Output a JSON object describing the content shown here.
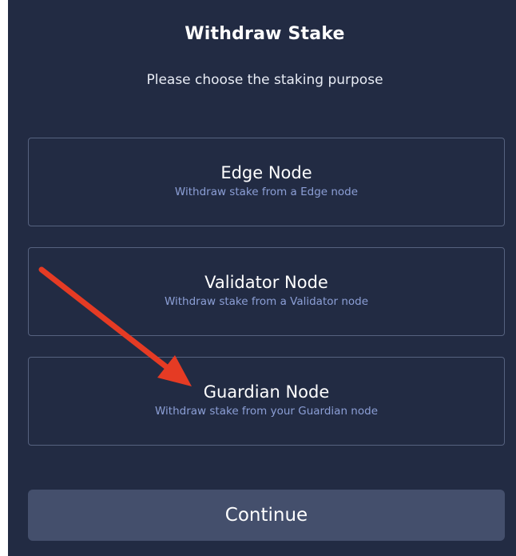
{
  "dialog": {
    "title": "Withdraw Stake",
    "subtitle": "Please choose the staking purpose"
  },
  "options": [
    {
      "title": "Edge Node",
      "description": "Withdraw stake from a Edge node"
    },
    {
      "title": "Validator Node",
      "description": "Withdraw stake from a Validator node"
    },
    {
      "title": "Guardian Node",
      "description": "Withdraw stake from your Guardian node"
    }
  ],
  "footer": {
    "continue_label": "Continue"
  },
  "annotation": {
    "icon": "red-arrow-icon",
    "color": "#e53b24",
    "points_to": "Guardian Node"
  },
  "colors": {
    "background": "#222b43",
    "border": "#56627f",
    "description": "#8c9fd6",
    "button": "#444f6c"
  }
}
